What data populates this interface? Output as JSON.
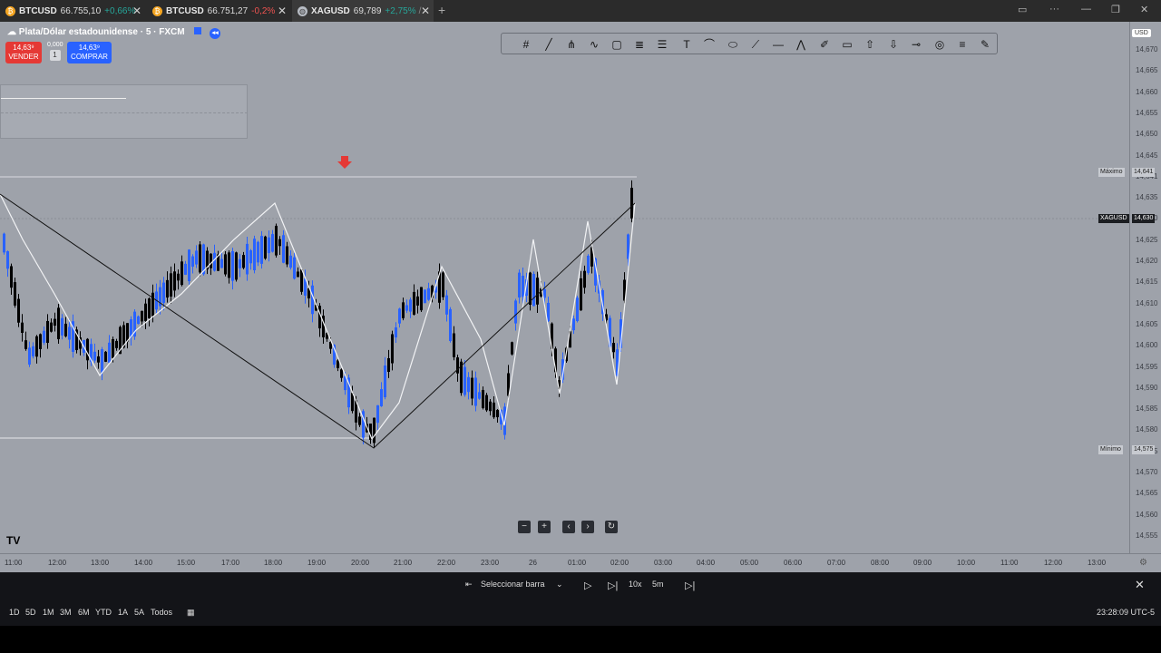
{
  "tabs": [
    {
      "symbol": "BTCUSD",
      "price": "66.755,10",
      "change": "+0,66%",
      "dir": "up",
      "icon": "bitcoin-icon"
    },
    {
      "symbol": "BTCUSD",
      "price": "66.751,27",
      "change": "-0,2%",
      "dir": "down",
      "icon": "bitcoin-icon"
    },
    {
      "symbol": "XAGUSD",
      "price": "69,789",
      "change": "+2,75%",
      "dir": "up",
      "extra": "/",
      "icon": "silver-icon"
    }
  ],
  "symbol_title": "Plata/Dólar estadounidense · 5 · FXCM",
  "sell": {
    "price": "14,63⁹",
    "label": "VENDER"
  },
  "buy": {
    "price": "14,63⁹",
    "label": "COMPRAR"
  },
  "qty": {
    "spread": "0,000",
    "value": "1"
  },
  "currency": "USD",
  "price_ticks": [
    "14,670",
    "14,665",
    "14,660",
    "14,655",
    "14,650",
    "14,645",
    "14,641",
    "14,635",
    "14,630",
    "14,625",
    "14,620",
    "14,615",
    "14,610",
    "14,605",
    "14,600",
    "14,595",
    "14,590",
    "14,585",
    "14,580",
    "14,575",
    "14,570",
    "14,565",
    "14,560",
    "14,555"
  ],
  "labels": {
    "max_label": "Máximo",
    "max_value": "14,641",
    "sym_label": "XAGUSD",
    "sym_value": "14,630",
    "min_label": "Mínimo",
    "min_value": "14,575"
  },
  "time_ticks": [
    "11:00",
    "12:00",
    "13:00",
    "14:00",
    "15:00",
    "17:00",
    "18:00",
    "19:00",
    "20:00",
    "21:00",
    "22:00",
    "23:00",
    "26",
    "01:00",
    "02:00",
    "03:00",
    "04:00",
    "05:00",
    "06:00",
    "07:00",
    "08:00",
    "09:00",
    "10:00",
    "11:00",
    "12:00",
    "13:00"
  ],
  "replay": {
    "select_bar": "Seleccionar barra",
    "speed": "10x",
    "interval": "5m"
  },
  "ranges": [
    "1D",
    "5D",
    "1M",
    "3M",
    "6M",
    "YTD",
    "1A",
    "5A",
    "Todos"
  ],
  "clock": "23:28:09 UTC-5",
  "logo": "TV",
  "colors": {
    "up": "#2962ff",
    "down": "#000000",
    "background": "#9ea2aa"
  }
}
